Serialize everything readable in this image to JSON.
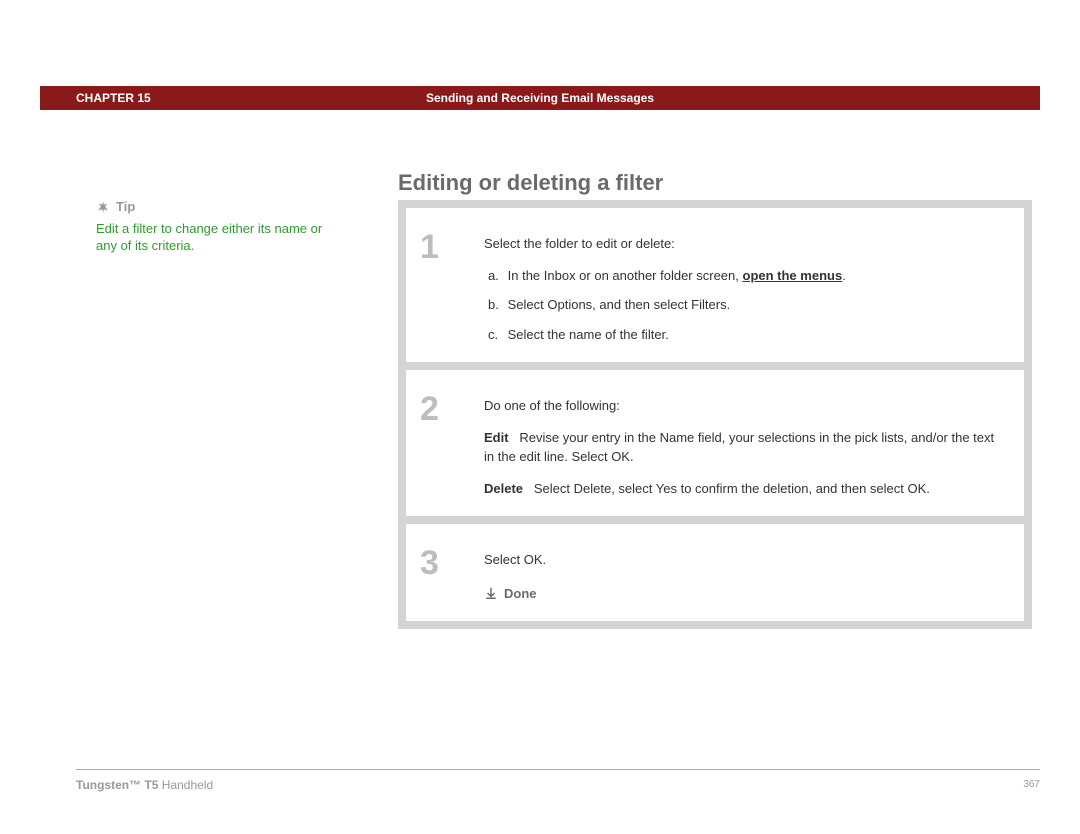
{
  "header": {
    "chapter_label": "CHAPTER 15",
    "topic": "Sending and Receiving Email Messages"
  },
  "sidebar": {
    "tip_label": "Tip",
    "tip_body": "Edit a filter to change either its name or any of its criteria."
  },
  "main": {
    "title": "Editing or deleting a filter",
    "steps": [
      {
        "num": "1",
        "intro": "Select the folder to edit or delete:",
        "subs": [
          {
            "letter": "a.",
            "pre": "In the Inbox or on another folder screen, ",
            "link": "open the menus",
            "post": "."
          },
          {
            "letter": "b.",
            "text": "Select Options, and then select Filters."
          },
          {
            "letter": "c.",
            "text": "Select the name of the filter."
          }
        ]
      },
      {
        "num": "2",
        "intro": "Do one of the following:",
        "pairs": [
          {
            "label": "Edit",
            "text": "Revise your entry in the Name field, your selections in the pick lists, and/or the text in the edit line. Select OK."
          },
          {
            "label": "Delete",
            "text": "Select Delete, select Yes to confirm the deletion, and then select OK."
          }
        ]
      },
      {
        "num": "3",
        "text": "Select OK.",
        "done_label": "Done"
      }
    ]
  },
  "footer": {
    "product_bold": "Tungsten™ T5",
    "product_rest": " Handheld",
    "page": "367"
  }
}
